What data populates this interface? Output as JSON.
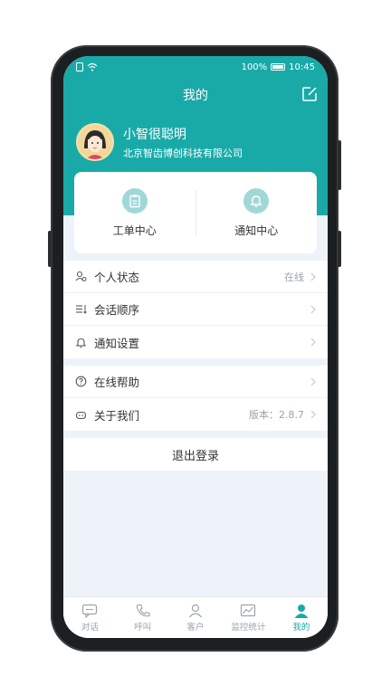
{
  "status_bar": {
    "battery": "100%",
    "time": "10:45"
  },
  "header": {
    "title": "我的"
  },
  "profile": {
    "name": "小智很聪明",
    "company": "北京智齿博创科技有限公司"
  },
  "quick_cards": [
    {
      "label": "工单中心",
      "icon": "clipboard-icon"
    },
    {
      "label": "通知中心",
      "icon": "bell-icon"
    }
  ],
  "settings_group_1": [
    {
      "label": "个人状态",
      "value": "在线",
      "icon": "user-status-icon"
    },
    {
      "label": "会话顺序",
      "value": "",
      "icon": "sort-icon"
    },
    {
      "label": "通知设置",
      "value": "",
      "icon": "bell-icon"
    }
  ],
  "settings_group_2": [
    {
      "label": "在线帮助",
      "value": "",
      "icon": "help-icon"
    },
    {
      "label": "关于我们",
      "value": "版本：2.8.7",
      "icon": "robot-icon"
    }
  ],
  "logout": {
    "label": "退出登录"
  },
  "tabbar": [
    {
      "label": "对话",
      "icon": "chat-icon",
      "active": false
    },
    {
      "label": "呼叫",
      "icon": "phone-icon",
      "active": false
    },
    {
      "label": "客户",
      "icon": "customer-icon",
      "active": false
    },
    {
      "label": "监控统计",
      "icon": "chart-icon",
      "active": false
    },
    {
      "label": "我的",
      "icon": "profile-icon",
      "active": true
    }
  ],
  "colors": {
    "accent": "#19aaa8",
    "background": "#eef3f9",
    "muted_text": "#9aa3ad"
  }
}
